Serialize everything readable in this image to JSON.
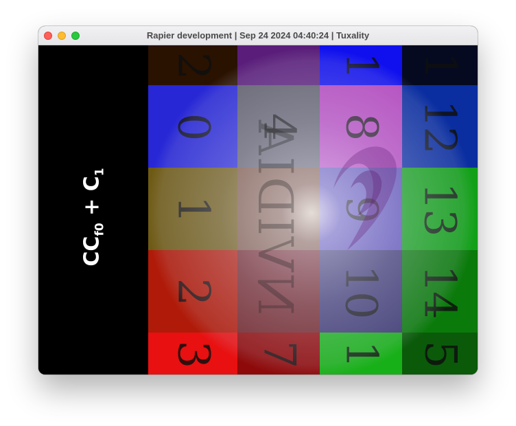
{
  "window": {
    "title": "Rapier development | Sep 24 2024 04:40:24 | Tuxality"
  },
  "panel": {
    "formula": {
      "c1": "C",
      "c2": "C",
      "sub_f": "f",
      "sub_0": "0",
      "plus": " + ",
      "c3": "C",
      "sub_1": "1"
    }
  },
  "grid": {
    "cells": [
      {
        "label": "2",
        "color": "#2a1200"
      },
      {
        "label": "",
        "color": "#5a1e7a"
      },
      {
        "label": "1",
        "color": "#1010ee"
      },
      {
        "label": "1",
        "color": "#050a20"
      },
      {
        "label": "0",
        "color": "#2727d6"
      },
      {
        "label": "4",
        "color": "#5e5e6a"
      },
      {
        "label": "8",
        "color": "#b444be"
      },
      {
        "label": "12",
        "color": "#0a2ea0"
      },
      {
        "label": "1",
        "color": "#6e5a14"
      },
      {
        "label": "",
        "color": "#7a5440"
      },
      {
        "label": "9",
        "color": "#5c50b6"
      },
      {
        "label": "13",
        "color": "#12a018"
      },
      {
        "label": "2",
        "color": "#b01a08"
      },
      {
        "label": "",
        "color": "#6e2226"
      },
      {
        "label": "10",
        "color": "#3a3670"
      },
      {
        "label": "14",
        "color": "#0a7a0a"
      },
      {
        "label": "3",
        "color": "#e81010"
      },
      {
        "label": "7",
        "color": "#8e0a0a"
      },
      {
        "label": "1",
        "color": "#18b018"
      },
      {
        "label": "5",
        "color": "#0a5a0a"
      }
    ]
  },
  "overlay": {
    "logo_text": "NVIDIA"
  }
}
